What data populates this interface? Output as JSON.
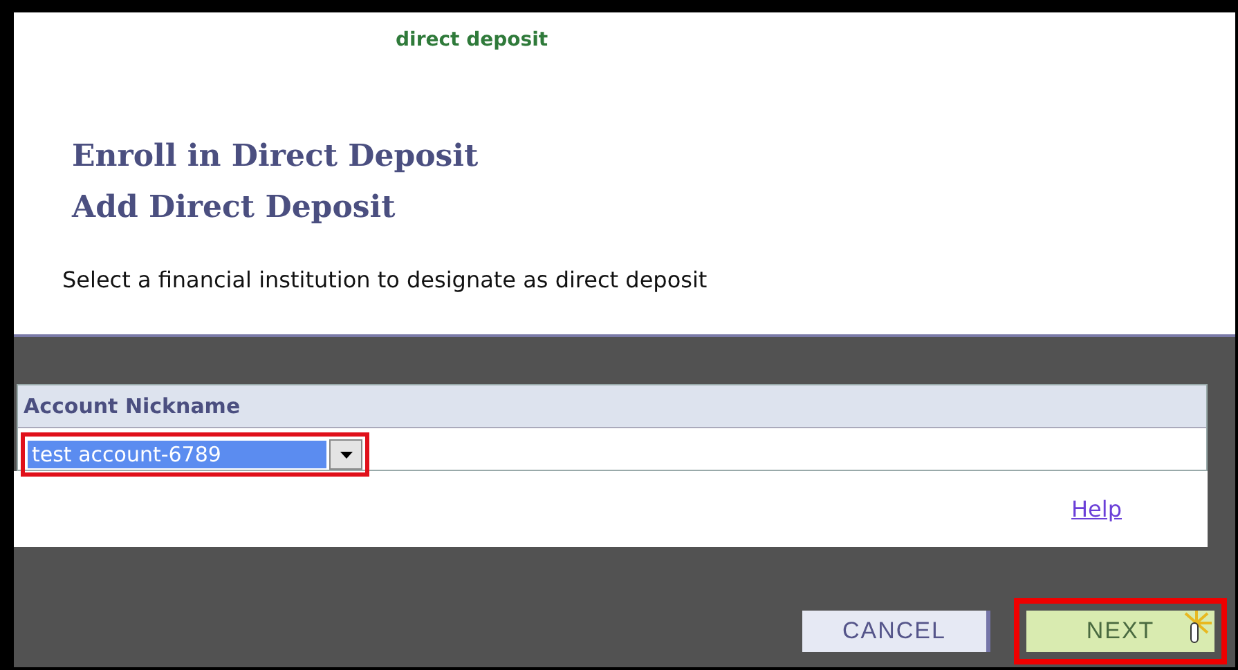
{
  "header": {
    "link": "direct deposit"
  },
  "titles": [
    "Enroll in Direct Deposit",
    "Add Direct Deposit"
  ],
  "instruction": "Select a financial institution to designate as direct deposit",
  "table": {
    "column": "Account Nickname",
    "dropdown": {
      "value": "test account-6789",
      "highlighted": true
    }
  },
  "help": "Help",
  "buttons": [
    {
      "label": "CANCEL",
      "kind": "secondary",
      "highlighted": false
    },
    {
      "label": "NEXT",
      "kind": "primary",
      "highlighted": true
    }
  ]
}
